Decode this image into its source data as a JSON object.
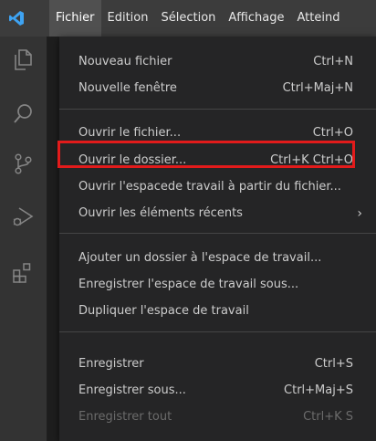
{
  "menubar": {
    "logo_icon": "vscode-logo-icon",
    "items": [
      "Fichier",
      "Edition",
      "Sélection",
      "Affichage",
      "Atteind"
    ]
  },
  "activity_bar": {
    "icons": [
      "explorer-icon",
      "search-icon",
      "source-control-icon",
      "run-debug-icon",
      "extensions-icon"
    ]
  },
  "file_menu": {
    "items": [
      {
        "label": "Nouveau fichier",
        "shortcut": "Ctrl+N"
      },
      {
        "label": "Nouvelle fenêtre",
        "shortcut": "Ctrl+Maj+N"
      },
      {
        "label": "Ouvrir le fichier...",
        "shortcut": "Ctrl+O"
      },
      {
        "label": "Ouvrir le dossier...",
        "shortcut": "Ctrl+K Ctrl+O"
      },
      {
        "label": "Ouvrir l'espacede travail à partir du fichier...",
        "shortcut": ""
      },
      {
        "label": "Ouvrir les éléments récents",
        "shortcut": "",
        "submenu": "›"
      },
      {
        "label": "Ajouter un dossier à l'espace de travail...",
        "shortcut": ""
      },
      {
        "label": "Enregistrer l'espace de travail sous...",
        "shortcut": ""
      },
      {
        "label": "Dupliquer l'espace de travail",
        "shortcut": ""
      },
      {
        "label": "Enregistrer",
        "shortcut": "Ctrl+S"
      },
      {
        "label": "Enregistrer sous...",
        "shortcut": "Ctrl+Maj+S"
      },
      {
        "label": "Enregistrer tout",
        "shortcut": "Ctrl+K S",
        "disabled": true
      }
    ]
  },
  "colors": {
    "highlight_border": "#e21b1b",
    "logo_blue": "#3ea3f2"
  }
}
